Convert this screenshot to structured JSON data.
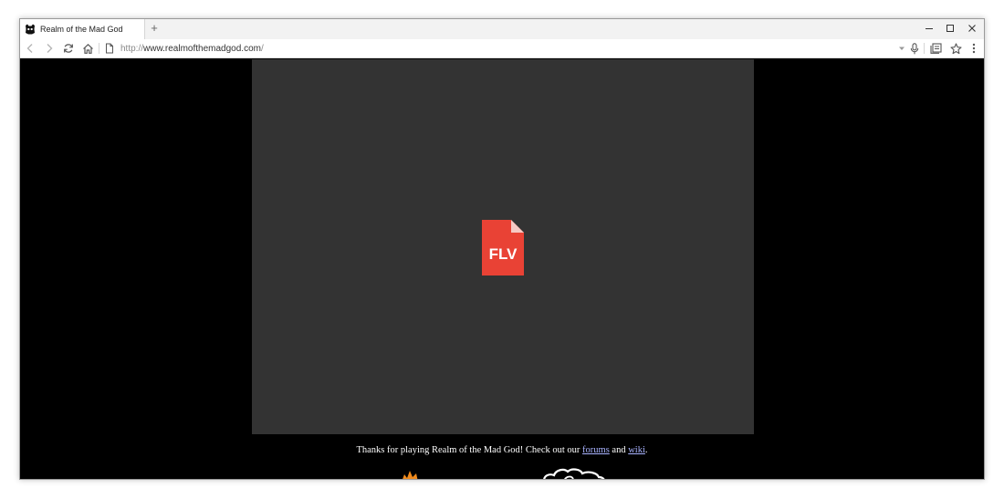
{
  "browser": {
    "tab_title": "Realm of the Mad God",
    "new_tab_label": "+",
    "url_scheme": "http://",
    "url_host": "www.realmofthemadgod.com",
    "url_path": "/"
  },
  "page": {
    "flash_placeholder_label": "FLV",
    "footer": {
      "text_before": "Thanks for playing Realm of the Mad God! Check out our ",
      "forums_link": "forums",
      "text_middle": " and ",
      "wiki_link": "wiki",
      "text_after": "."
    }
  },
  "icons": {
    "back": "back-arrow-icon",
    "forward": "forward-arrow-icon",
    "reload": "reload-icon",
    "home": "home-icon",
    "page": "page-info-icon",
    "dropdown": "dropdown-icon",
    "mic": "microphone-icon",
    "reader": "reading-list-icon",
    "star": "bookmark-star-icon",
    "menu": "more-menu-icon"
  },
  "colors": {
    "flash_bg": "#333333",
    "flv_badge": "#e94235",
    "link": "#a9b3ff"
  }
}
